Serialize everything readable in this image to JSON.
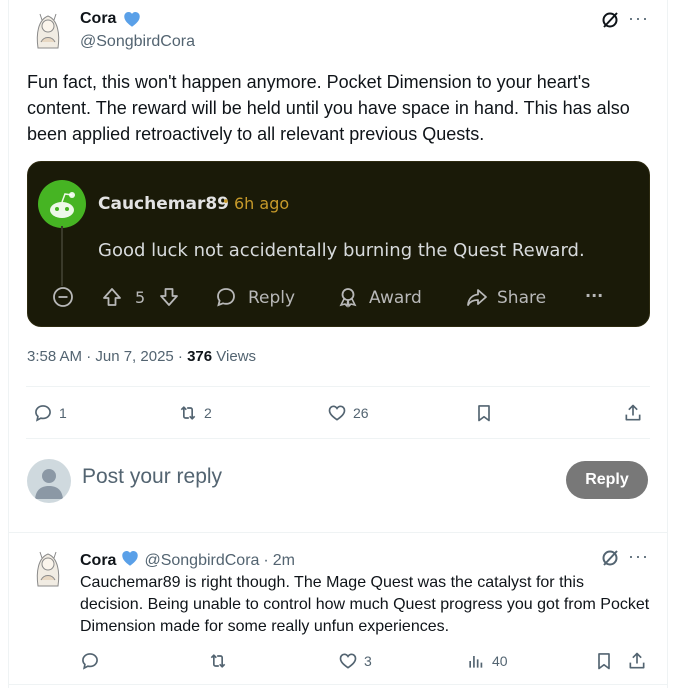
{
  "main_post": {
    "author_name": "Cora",
    "author_handle": "@SongbirdCora",
    "text": "Fun fact, this won't happen anymore. Pocket Dimension to your heart's content. The reward will be held until you have space in hand. This has also been applied retroactively to all relevant previous Quests.",
    "timestamp": "3:58 AM · Jun 7, 2025 · ",
    "views_count": "376",
    "views_label": " Views",
    "replies": "1",
    "reposts": "2",
    "likes": "26"
  },
  "embedded": {
    "username": "Cauchemar89",
    "dot": "•",
    "time": "6h ago",
    "comment": "Good luck not accidentally burning the Quest Reward.",
    "votes": "5",
    "reply_label": "Reply",
    "award_label": "Award",
    "share_label": "Share",
    "more_label": "···"
  },
  "reply_box": {
    "placeholder": "Post your reply",
    "button_label": "Reply"
  },
  "reply_post": {
    "author_name": "Cora",
    "author_handle": "@SongbirdCora",
    "sep": "·",
    "time": "2m",
    "text": "Cauchemar89 is right though. The Mage Quest was the catalyst for this decision. Being unable to control how much Quest progress you got from Pocket Dimension made for some really unfun experiences.",
    "likes": "3",
    "views": "40"
  },
  "colors": {
    "verified": "#5aa0e8",
    "reply_button": "#787878",
    "reddit_bg": "#1a1a08",
    "reddit_time": "#c79a2a",
    "reddit_avatar": "#46b423"
  }
}
